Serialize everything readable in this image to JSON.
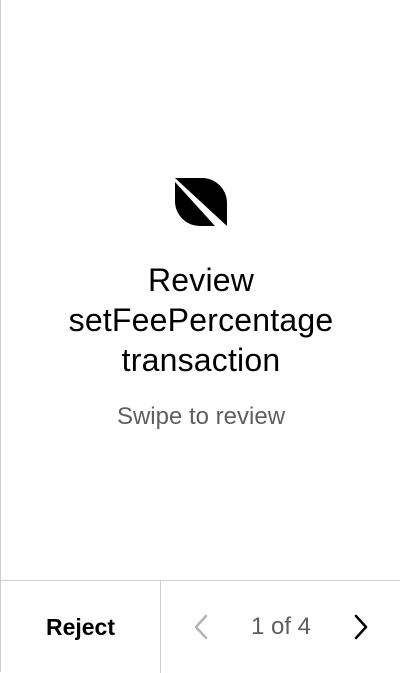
{
  "review": {
    "title_line1": "Review",
    "title_line2": "setFeePercentage",
    "title_line3": "transaction",
    "subtitle": "Swipe to review",
    "logo_icon": "ontology-logo-icon"
  },
  "footer": {
    "reject_label": "Reject",
    "page_indicator": "1 of 4",
    "prev_icon": "chevron-left-icon",
    "next_icon": "chevron-right-icon"
  },
  "colors": {
    "background": "#ffffff",
    "text": "#000000",
    "secondary_text": "#5f5f5f",
    "divider": "#cfcfcf",
    "disabled_icon": "#b3b3b3"
  }
}
